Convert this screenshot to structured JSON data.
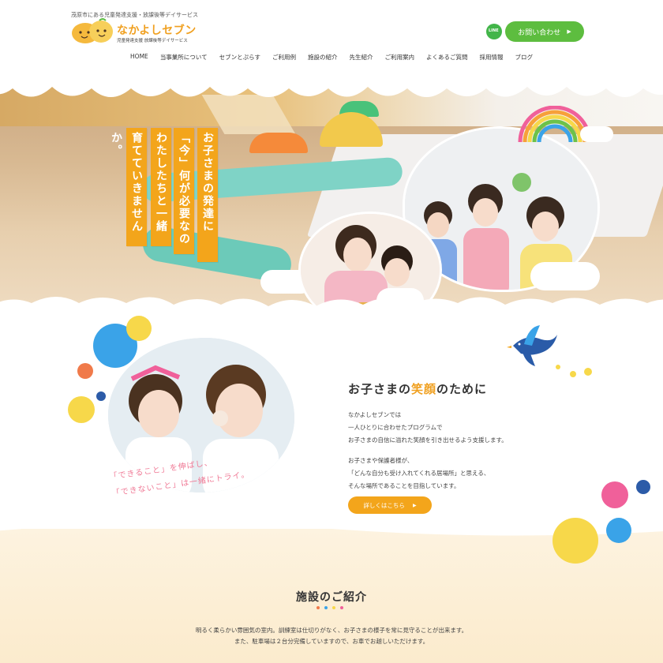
{
  "header": {
    "tagline": "茂原市にある児童発達支援・放課後等デイサービス",
    "logo_title": "なかよしセブン",
    "logo_sub": "児童発達支援 放課後等デイサービス",
    "line_label": "LINE",
    "contact_label": "お問い合わせ",
    "nav": [
      "HOME",
      "当事業所について",
      "セブンとぷらす",
      "ご利用例",
      "施設の紹介",
      "先生紹介",
      "ご利用案内",
      "よくあるご質問",
      "採用情報",
      "ブログ"
    ]
  },
  "hero": {
    "copy": [
      "お子さまの発達に",
      "「今」何が必要なのか。",
      "わたしたちと一緒に",
      "育てていきませんか。"
    ]
  },
  "about": {
    "title_pre": "お子さまの",
    "title_highlight": "笑顔",
    "title_post": "のために",
    "body": [
      "なかよしセブンでは",
      "一人ひとりに合わせたプログラムで",
      "お子さまの自信に溢れた笑顔を引き出せるよう支援します。",
      "",
      "お子さまや保護者様が、",
      "「どんな自分も受け入れてくれる居場所」と思える、",
      "そんな場所であることを目指しています。"
    ],
    "hand_text_1": "「できること」を伸ばし、",
    "hand_text_2": "「できないこと」は一緒にトライ。",
    "more_label": "詳しくはこちら"
  },
  "facility": {
    "title": "施設のご紹介",
    "body": [
      "明るく柔らかい雰囲気の室内。訓練室は仕切りがなく、お子さまの様子を常に見守ることが出来ます。",
      "また、駐車場は２台分完備していますので、お車でお越しいただけます。"
    ]
  },
  "colors": {
    "accent": "#f3a51b",
    "contact_green": "#5dbd3f",
    "pink_text": "#f07a96",
    "dot_blue": "#3aa3e8",
    "dot_yellow": "#f7d84a",
    "dot_pink": "#f0609a",
    "dot_green": "#6cc24a",
    "dot_orange": "#f07a4a"
  },
  "icons": {
    "line": "line-icon",
    "arrow": "arrow-right-icon",
    "bird": "bird-icon",
    "rainbow": "rainbow-icon"
  }
}
